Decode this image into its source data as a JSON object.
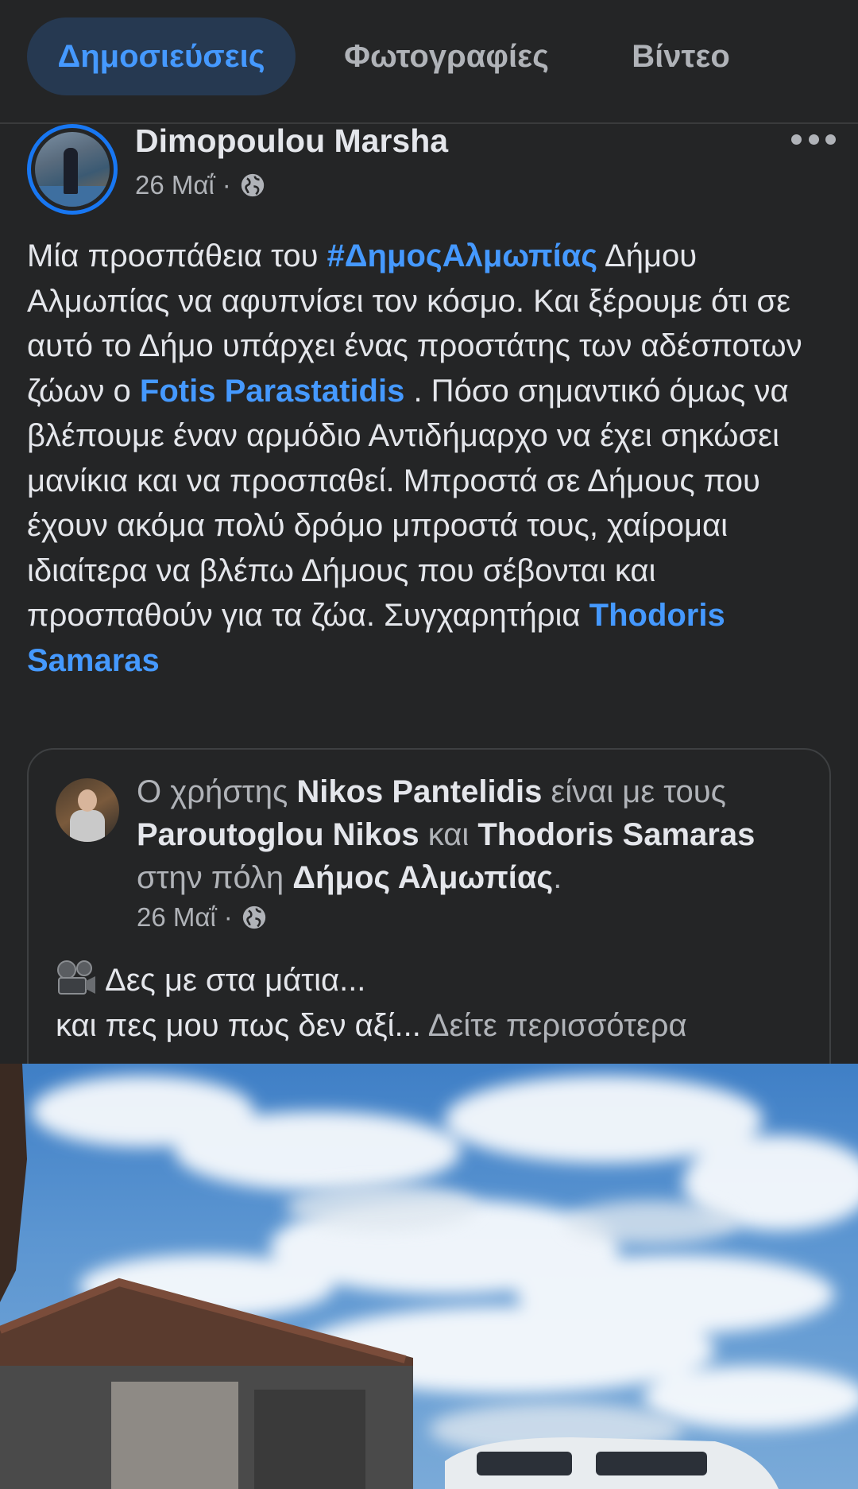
{
  "tabs": [
    {
      "label": "Δημοσιεύσεις",
      "active": true
    },
    {
      "label": "Φωτογραφίες",
      "active": false
    },
    {
      "label": "Βίντεο",
      "active": false
    }
  ],
  "post": {
    "author": "Dimopoulou Marsha",
    "date": "26 Μαΐ",
    "separator": "·",
    "privacy_icon": "globe-icon",
    "menu_icon": "more-dots-icon",
    "text": {
      "p1": "Μία προσπάθεια του ",
      "hashtag": "#ΔημοςΑλμωπίας",
      "p2": " Δήμου Αλμωπίας να αφυπνίσει τον κόσμο. Και ξέρουμε ότι σε αυτό το  Δήμο υπάρχει ένας προστάτης των αδέσποτων ζώων ο ",
      "mention1": "Fotis Parastatidis",
      "p3": " . Πόσο σημαντικό όμως να βλέπουμε έναν αρμόδιο Αντιδήμαρχο να έχει σηκώσει μανίκια και να προσπαθεί. Μπροστά σε Δήμους που έχουν ακόμα πολύ δρόμο μπροστά τους, χαίρομαι ιδιαίτερα να βλέπω Δήμους που σέβονται και προσπαθούν για τα ζώα. Συγχαρητήρια ",
      "mention2": "Thodoris Samaras"
    }
  },
  "shared": {
    "prefix": "Ο χρήστης ",
    "user": "Nikos Pantelidis",
    "with_text": " είναι με τους ",
    "tag1": "Paroutoglou Nikos",
    "and_text": " και ",
    "tag2": "Thodoris Samaras",
    "in_text": " στην πόλη ",
    "place": "Δήμος Αλμωπίας",
    "end": ".",
    "date": "26 Μαΐ",
    "separator": "·",
    "line1": "Δες με στα μάτια...",
    "line2": "και πες μου πως δεν αξί... ",
    "see_more": "Δείτε περισσότερα",
    "emoji_icon": "film-projector-icon"
  },
  "colors": {
    "background": "#242526",
    "accent": "#4599ff",
    "active_tab_bg": "#263951",
    "secondary_text": "#b0b3b8"
  }
}
